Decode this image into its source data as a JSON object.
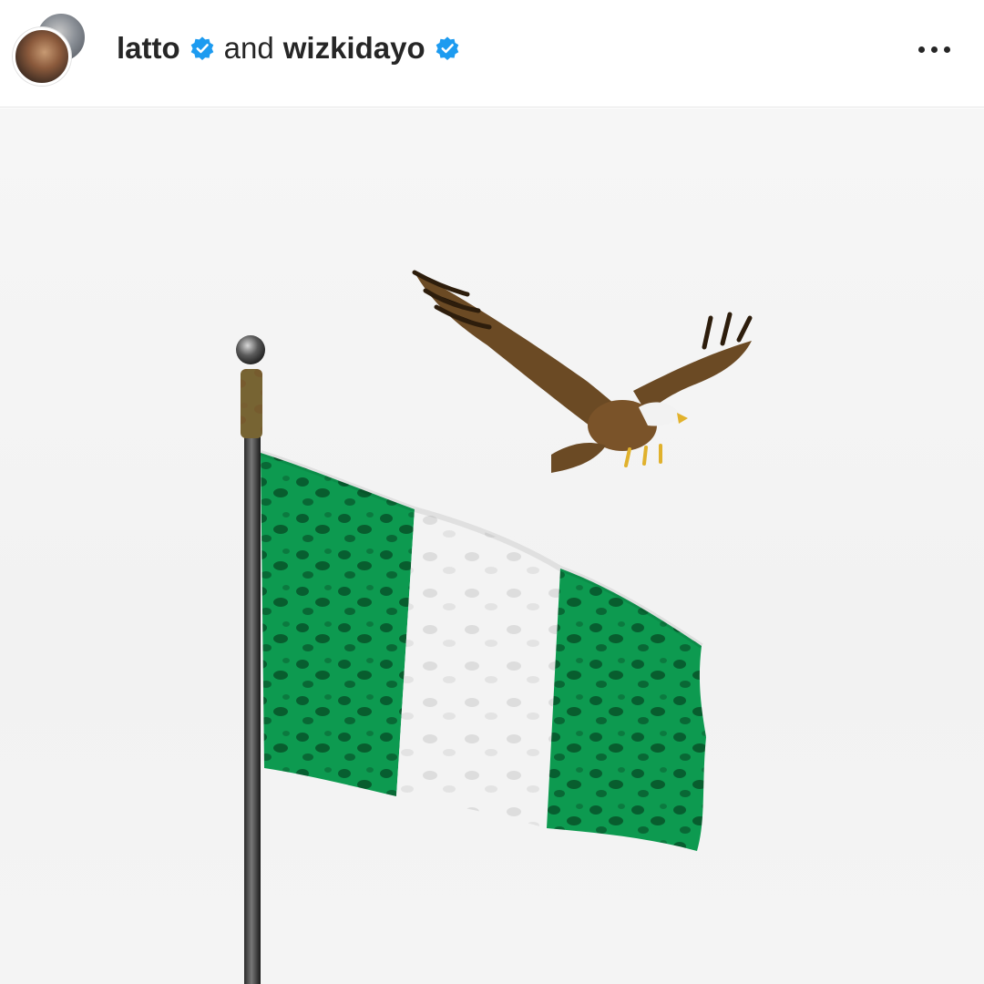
{
  "post": {
    "author_primary": "latto",
    "joiner": "and",
    "author_secondary": "wizkidayo",
    "verified_color": "#1d9bf0"
  },
  "icons": {
    "verified": "verified-badge-icon",
    "more": "more-horizontal-icon"
  },
  "media": {
    "flag_colors": [
      "#0a8a48",
      "#f3f3f3",
      "#0a8a48"
    ],
    "background": "#f4f4f4"
  }
}
